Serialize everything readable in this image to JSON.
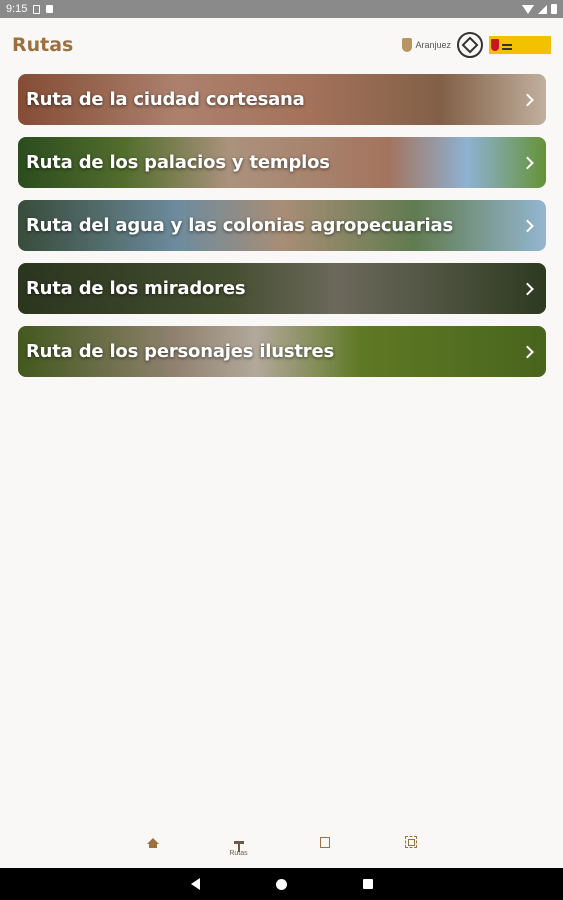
{
  "status_bar": {
    "time": "9:15"
  },
  "header": {
    "title": "Rutas",
    "logo_text": "Aranjuez"
  },
  "routes": [
    {
      "label": "Ruta de la ciudad cortesana"
    },
    {
      "label": "Ruta de los palacios y templos"
    },
    {
      "label": "Ruta del agua y las colonias agropecuarias"
    },
    {
      "label": "Ruta de los miradores"
    },
    {
      "label": "Ruta de los personajes ilustres"
    }
  ],
  "bottom_nav": {
    "items": [
      {
        "icon": "home-icon",
        "label": ""
      },
      {
        "icon": "signpost-icon",
        "label": "Rutas"
      },
      {
        "icon": "map-icon",
        "label": ""
      },
      {
        "icon": "scan-icon",
        "label": ""
      }
    ]
  },
  "colors": {
    "accent": "#9c7140",
    "background": "#faf8f6"
  }
}
